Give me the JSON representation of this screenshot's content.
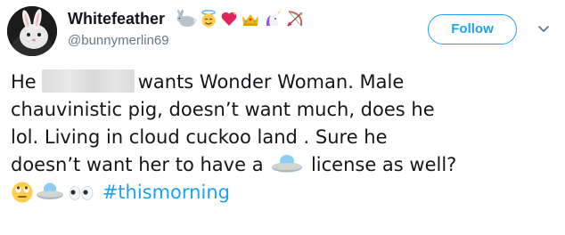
{
  "tweet": {
    "author": {
      "display_name": "Whitefeather",
      "handle": "@bunnymerlin69",
      "name_emojis": [
        "rabbit-emoji",
        "angel-face-emoji",
        "sparkling-heart-emoji",
        "crown-emoji",
        "unicorn-emoji",
        "bow-and-arrow-emoji"
      ]
    },
    "follow_label": "Follow",
    "text": {
      "line1_before": "He",
      "line1_after": "wants Wonder Woman. Male",
      "line2": "chauvinistic pig, doesn’t want much, does he",
      "line3": "lol. Living in cloud cuckoo land . Sure he",
      "line4_before": "doesn’t want her to have a",
      "line4_after": "license as well?",
      "hashtag": "#thismorning"
    },
    "text_emojis": [
      "flying-saucer-emoji",
      "face-with-rolling-eyes-emoji",
      "flying-saucer-emoji",
      "eyes-emoji"
    ]
  },
  "colors": {
    "accent": "#1da1f2",
    "text": "#14171a",
    "secondary_text": "#657786"
  }
}
